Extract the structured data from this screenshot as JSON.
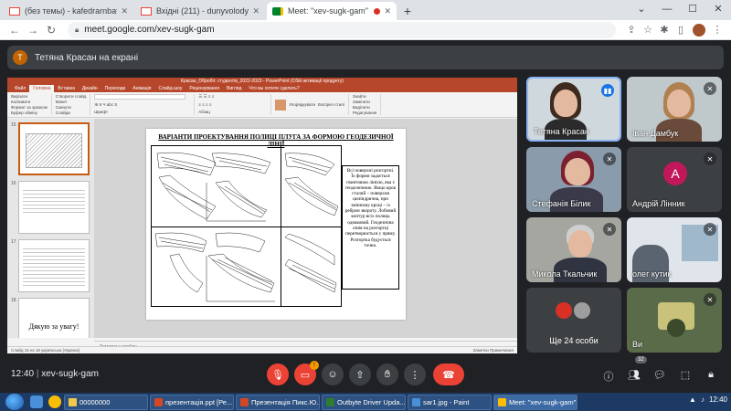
{
  "browser": {
    "tabs": [
      {
        "label": "(без темы) - kafedrarnbati@gm",
        "icon": "gmail-icon",
        "active": false
      },
      {
        "label": "Вхідні (211) - dunyvolodya@gma",
        "icon": "gmail-icon",
        "active": false
      },
      {
        "label": "Meet: \"xev-sugk-gam\"",
        "icon": "meet-icon",
        "active": true
      }
    ],
    "new_tab": "+",
    "url": "meet.google.com/xev-sugk-gam"
  },
  "banner": {
    "initial": "Т",
    "text": "Тетяна Красан на екрані"
  },
  "powerpoint": {
    "window_title": "Красан_Обробіт. студентів_2022-2023 - PowerPoint (Сбій активації продукту)",
    "ribbon_tabs": [
      "Файл",
      "Головна",
      "Вставка",
      "Дизайн",
      "Переходи",
      "Анімація",
      "Слайд-шоу",
      "Рецензування",
      "Вигляд",
      "Что вы хотите сделать?"
    ],
    "ribbon_groups": [
      [
        "Вирізати",
        "Копіювати",
        "Формат за зразком",
        "Буфер обміну"
      ],
      [
        "Створити слайд",
        "Макет",
        "Скинути",
        "Розділ",
        "Слайди"
      ],
      [
        "Шрифт"
      ],
      [
        "Абзац"
      ],
      [
        "Упорядкувати",
        "Експрес-стилі",
        "Малювання"
      ],
      [
        "Знайти",
        "Замінити",
        "Виділити",
        "Редагування"
      ]
    ],
    "thumb_numbers": [
      "15",
      "16",
      "17",
      "18"
    ],
    "thumb_thanks": "Дякую за увагу!",
    "slide": {
      "title": "ВАРІАНТИ ПРОЕКТУВАННЯ ПОЛИЦІ ПЛУГА ЗА ФОРМОЮ ГЕОДЕЗИЧНОЇ ЛІНІЇ",
      "text": "Всі поверхні розгортні. Їх форми задається гвинтовою лінією, яка є геодезичною. Якщо крок сталий – поверхня циліндрична, при змінному кроці – із ребром звороту. Лобовий контур всіх полиць однаковий. Геодезична лінія на розгортці перетворюється у пряму. Розгортка будується точно."
    },
    "notes": "Заметки к слайду",
    "status_left": "Слайд 15 из 18   українська (Україна)",
    "status_right": "Заметки   Примечания"
  },
  "participants": [
    {
      "name": "Тетяна Красан",
      "mic": "on",
      "speaking": true
    },
    {
      "name": "Іван Дамбук",
      "mic": "off"
    },
    {
      "name": "Стефанія Білик",
      "mic": "off"
    },
    {
      "name": "Андрій Лінник",
      "mic": "off",
      "avatar_letter": "А"
    },
    {
      "name": "Микола Ткальчик",
      "mic": "off"
    },
    {
      "name": "олег кутик",
      "mic": "off"
    },
    {
      "name": "Ще 24 особи",
      "mic": "none"
    },
    {
      "name": "Ви",
      "mic": "off"
    }
  ],
  "meeting": {
    "time": "12:40",
    "code": "xev-sugk-gam",
    "present_badge": "!",
    "people_count": "32"
  },
  "taskbar": {
    "items": [
      {
        "label": "00000000",
        "color": "#f2c94c"
      },
      {
        "label": "презентація.ppt [Ре...",
        "color": "#d24726"
      },
      {
        "label": "Презентація Пикс.Ю...",
        "color": "#d24726"
      },
      {
        "label": "Outbyte Driver Upda...",
        "color": "#2e7d32"
      },
      {
        "label": "sar1.jpg - Paint",
        "color": "#4a90d9"
      },
      {
        "label": "Meet: \"xev-sugk-gam\"",
        "color": "#fbbc04"
      }
    ],
    "clock": "12:40"
  }
}
